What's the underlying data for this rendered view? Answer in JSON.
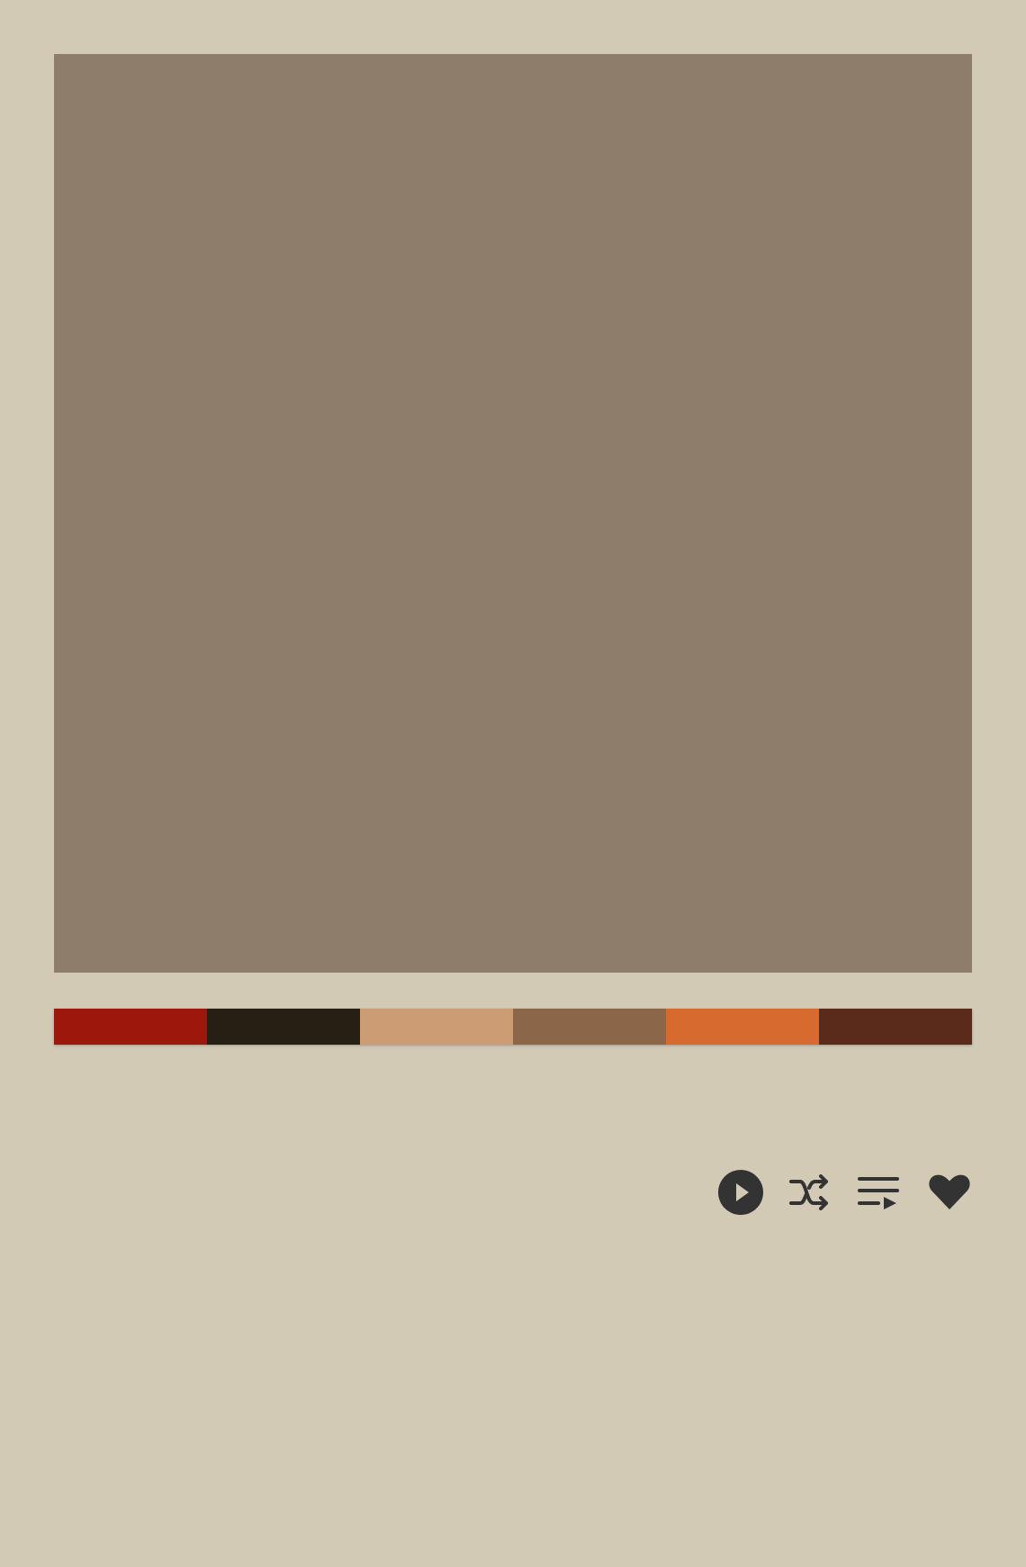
{
  "artwork": {
    "color": "#8f7d6b"
  },
  "palette": {
    "swatches": [
      "#9c180c",
      "#262014",
      "#cc9d74",
      "#8c6648",
      "#d66a2f",
      "#5a2a1a"
    ]
  },
  "controls": {
    "icon_color": "#333333",
    "play_icon": "play-circle-icon",
    "shuffle_icon": "shuffle-icon",
    "queue_icon": "queue-music-icon",
    "like_icon": "heart-icon"
  }
}
